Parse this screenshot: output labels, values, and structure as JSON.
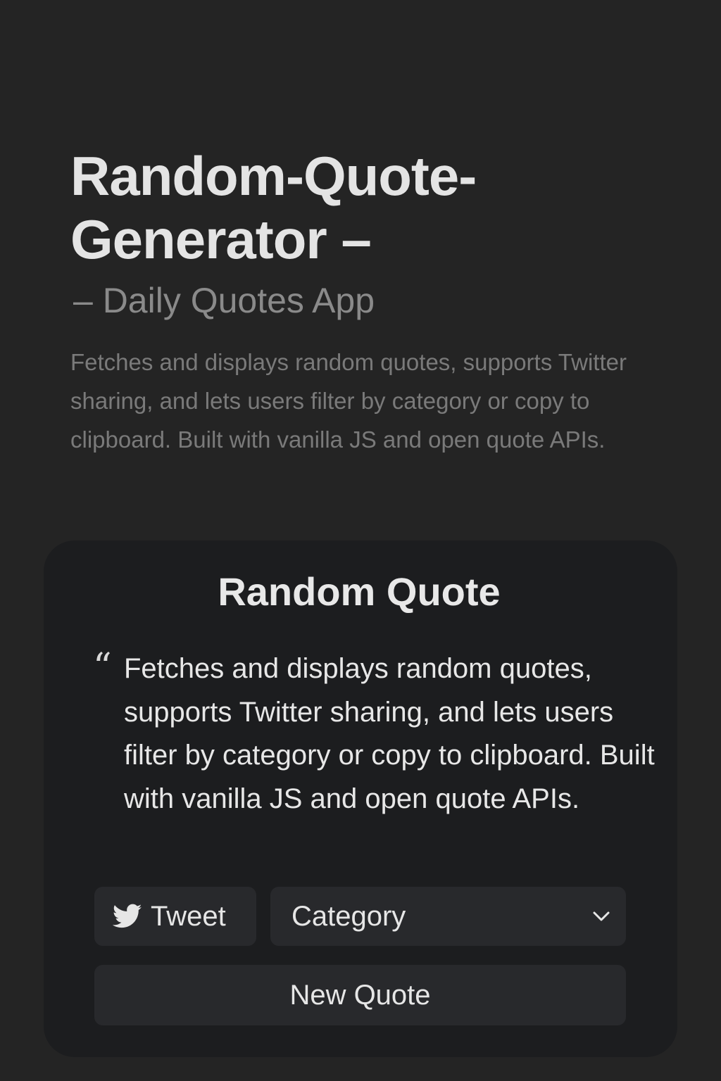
{
  "header": {
    "title": "Random-Quote-Generator –",
    "subtitle": "– Daily Quotes App",
    "description": "Fetches and displays random quotes, supports Twitter sharing, and lets users filter by category or copy to clipboard. Built with vanilla JS and open quote APIs."
  },
  "card": {
    "title": "Random Quote",
    "quote_mark": "“",
    "quote_text": "Fetches and displays random quotes, supports Twitter sharing, and lets users filter by category or copy to clipboard. Built with vanilla JS and open quote APIs.",
    "tweet_label": "Tweet",
    "tweet_icon": "twitter-bird-icon",
    "category_value": "Category",
    "new_quote_label": "New Quote"
  },
  "colors": {
    "background": "#242424",
    "card": "#1c1d1f",
    "button": "#28292c",
    "text": "#e6e6e6",
    "muted": "#7a7a7a"
  }
}
